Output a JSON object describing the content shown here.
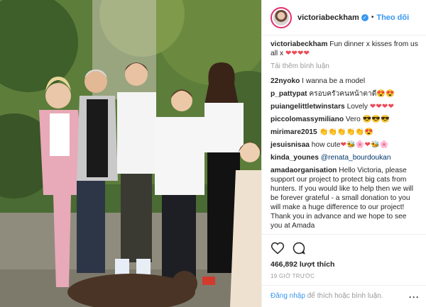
{
  "post": {
    "username": "victoriabeckham",
    "follow_label": "Theo dõi",
    "dot": "•",
    "caption_user": "victoriabeckham",
    "caption_text": "Fun dinner x kisses from us all x ",
    "caption_hearts": "❤❤❤❤",
    "load_more": "Tải thêm bình luận",
    "likes": "466,892 lượt thích",
    "time": "19 GIỜ TRƯỚC",
    "login_link": "Đăng nhập",
    "login_rest": " để thích hoặc bình luận.",
    "more_options": "···"
  },
  "comments": [
    {
      "user": "22nyoko",
      "text": " I wanna be a model"
    },
    {
      "user": "p_pattypat",
      "text": " ครอบครัวคนหน้าตาดี",
      "emoji": "😍😍"
    },
    {
      "user": "puiangelittletwinstars",
      "text": " Lovely",
      "emoji": "❤❤❤❤"
    },
    {
      "user": "piccolomassymiliano",
      "text": " Vero ",
      "emoji": "😎😎😎"
    },
    {
      "user": "mirimare2015",
      "text": " ",
      "emoji": "👏👏👏👏👏😍"
    },
    {
      "user": "jesuisnisaa",
      "text": " how cute",
      "emoji": "❤🐝🌸❤🐝🌸"
    },
    {
      "user": "kinda_younes",
      "text": " ",
      "mention": "@renata_bourdoukan"
    },
    {
      "user": "amadaorganisation",
      "text": " Hello Victoria, please support our project to protect big cats from hunters. If you would like to help then we will be forever grateful - a small donation to you will make a huge difference to our project! Thank you in advance and we hope to see you at Amada"
    }
  ],
  "colors": {
    "accent": "#3897f0",
    "heart": "#ed4956",
    "muted": "#999999"
  },
  "icons": [
    "verified-badge-icon",
    "heart-icon",
    "comment-icon",
    "more-options-icon"
  ]
}
